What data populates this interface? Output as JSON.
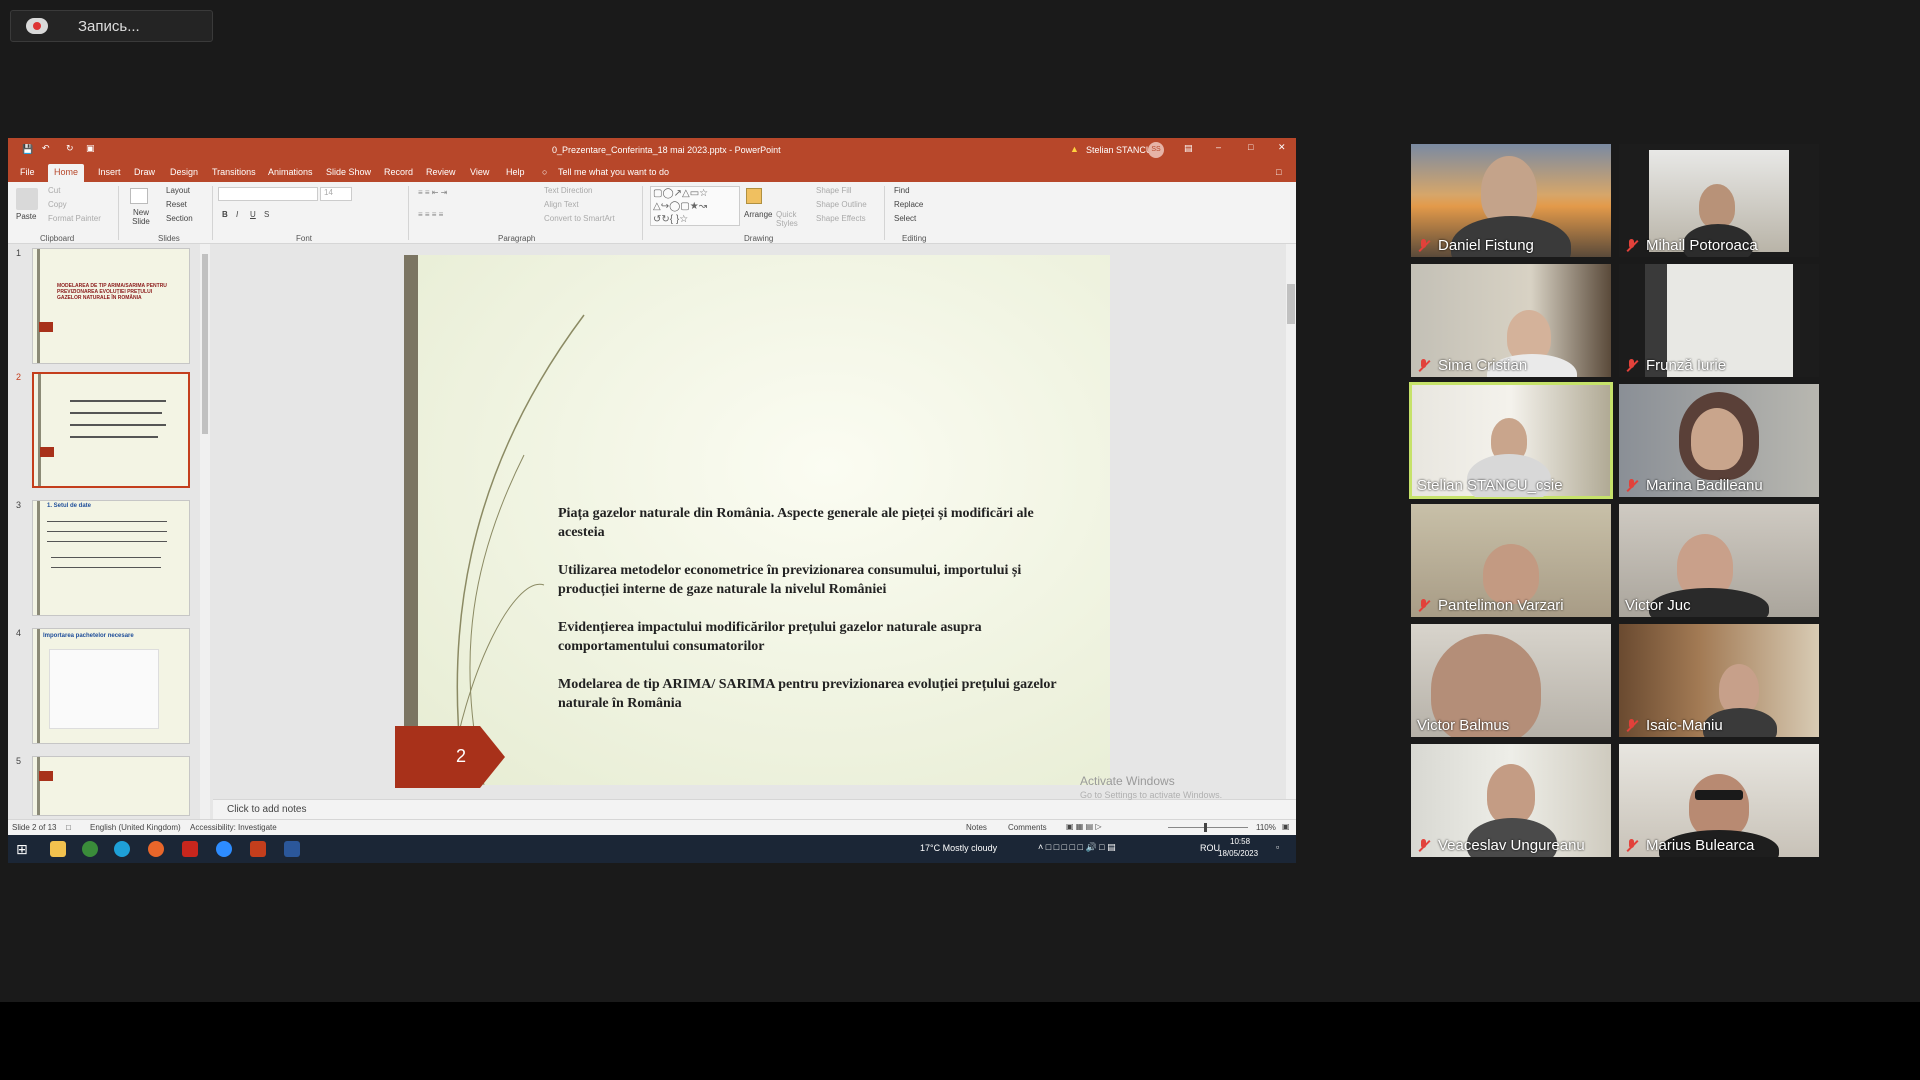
{
  "recording": {
    "label": "Запись..."
  },
  "powerpoint": {
    "title": "0_Prezentare_Conferinta_18 mai 2023.pptx  -  PowerPoint",
    "user": "Stelian STANCU",
    "user_initials": "SS",
    "tabs": [
      "File",
      "Home",
      "Insert",
      "Draw",
      "Design",
      "Transitions",
      "Animations",
      "Slide Show",
      "Record",
      "Review",
      "View",
      "Help"
    ],
    "active_tab": "Home",
    "tell_me": "Tell me what you want to do",
    "ribbon": {
      "clipboard": {
        "paste": "Paste",
        "cut": "Cut",
        "copy": "Copy",
        "format_painter": "Format Painter",
        "group": "Clipboard"
      },
      "slides": {
        "new_slide": "New Slide",
        "layout": "Layout",
        "reset": "Reset",
        "section": "Section",
        "group": "Slides"
      },
      "font": {
        "size": "14",
        "group": "Font"
      },
      "paragraph": {
        "text_direction": "Text Direction",
        "align_text": "Align Text",
        "convert_smartart": "Convert to SmartArt",
        "group": "Paragraph"
      },
      "drawing": {
        "arrange": "Arrange",
        "quick_styles": "Quick Styles",
        "shape_fill": "Shape Fill",
        "shape_outline": "Shape Outline",
        "shape_effects": "Shape Effects",
        "group": "Drawing"
      },
      "editing": {
        "find": "Find",
        "replace": "Replace",
        "select": "Select",
        "group": "Editing"
      }
    },
    "thumbnails": [
      {
        "num": "1",
        "title": "MODELAREA DE TIP ARIMA/SARIMA PENTRU PREVIZIONAREA EVOLUȚIEI PREȚULUI GAZELOR NATURALE ÎN ROMÂNIA"
      },
      {
        "num": "2",
        "title": ""
      },
      {
        "num": "3",
        "title": "1. Setul de date"
      },
      {
        "num": "4",
        "title": "Importarea pachetelor necesare"
      },
      {
        "num": "5",
        "title": ""
      }
    ],
    "slide": {
      "number": "2",
      "bullets": [
        "Piața gazelor naturale din România. Aspecte generale ale pieței și modificări ale acesteia",
        "Utilizarea metodelor econometrice în previzionarea consumului, importului și producției interne de gaze naturale la nivelul României",
        "Evidențierea impactului modificărilor prețului gazelor naturale asupra comportamentului consumatorilor",
        "Modelarea de tip ARIMA/ SARIMA pentru previzionarea evoluției prețului gazelor naturale în România"
      ]
    },
    "notes_placeholder": "Click to add notes",
    "status": {
      "slide_of": "Slide 2 of 13",
      "language": "English (United Kingdom)",
      "accessibility": "Accessibility: Investigate",
      "notes": "Notes",
      "comments": "Comments",
      "zoom": "110%"
    },
    "watermark": {
      "title": "Activate Windows",
      "sub": "Go to Settings to activate Windows."
    }
  },
  "taskbar": {
    "weather": "17°C  Mostly cloudy",
    "lang": "ROU",
    "time": "10:58",
    "date": "18/05/2023"
  },
  "participants": [
    {
      "name": "Daniel Fistung",
      "muted": true
    },
    {
      "name": "Mihail Potoroaca",
      "muted": true
    },
    {
      "name": "Sima Cristian",
      "muted": true
    },
    {
      "name": "Frunză Iurie",
      "muted": true
    },
    {
      "name": "Stelian STANCU_csie",
      "muted": false,
      "active": true
    },
    {
      "name": "Marina Badileanu",
      "muted": true
    },
    {
      "name": "Pantelimon Varzari",
      "muted": true
    },
    {
      "name": "Victor Juc",
      "muted": false
    },
    {
      "name": "Victor Balmus",
      "muted": false
    },
    {
      "name": "Isaic-Maniu",
      "muted": true
    },
    {
      "name": "Veaceslav Ungureanu",
      "muted": true
    },
    {
      "name": "Marius Bulearca",
      "muted": true
    }
  ],
  "colors": {
    "accent": "#b7472a",
    "active_speaker": "#c6e26a",
    "muted_icon": "#e2413a",
    "slide_number_arrow": "#a8311a"
  }
}
